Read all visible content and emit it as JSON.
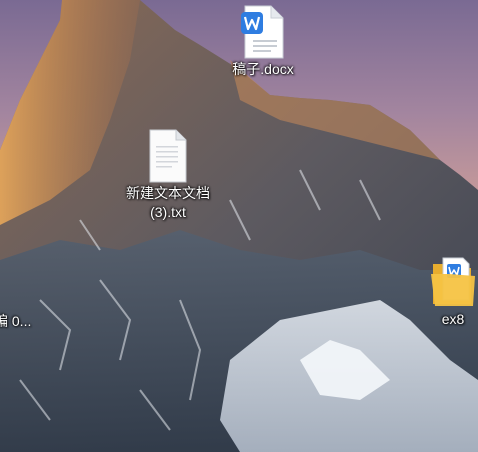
{
  "desktop": {
    "icons": [
      {
        "name": "稿子.docx",
        "icon": "wps-word-document-icon"
      },
      {
        "name": "新建文本文档\n(3).txt",
        "icon": "text-document-icon"
      },
      {
        "name": "ex8",
        "icon": "folder-with-word-document-icon"
      },
      {
        "name": "编\n0...",
        "icon": "truncated-desktop-item"
      }
    ]
  },
  "colors": {
    "word_blue": "#2f7de1",
    "folder_yellow": "#f6c343",
    "label_text": "#ffffff"
  }
}
